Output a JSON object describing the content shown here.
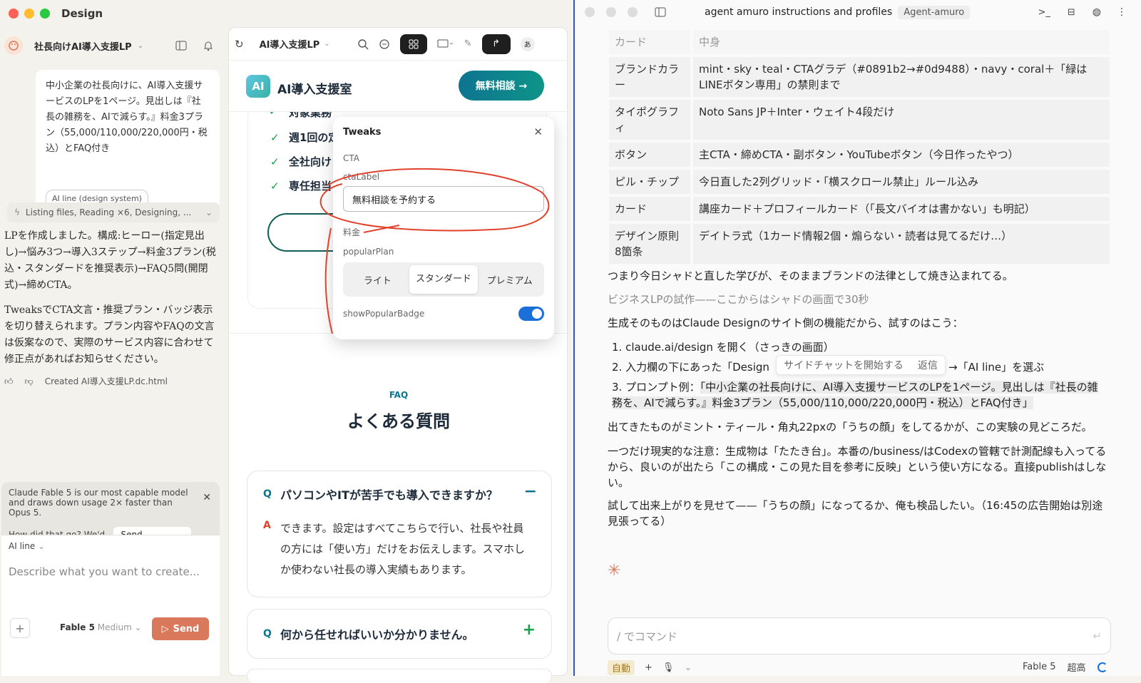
{
  "left_window": {
    "title": "Design",
    "project_name": "社長向けAI導入支援LP",
    "user_prompt": "中小企業の社長向けに、AI導入支援サービスのLPを1ページ。見出しは『社長の雑務を、AIで減らす。』料金3プラン（55,000/110,000/220,000円・税込）とFAQ付き",
    "prompt_tag": "AI line (design system)",
    "activity_label": "Listing files, Reading ×6, Designing, ...",
    "assistant_p1": "LPを作成しました。構成:ヒーロー(指定見出し)→悩み3つ→導入3ステップ→料金3プラン(税込・スタンダードを推奨表示)→FAQ5問(開閉式)→締めCTA。",
    "assistant_p2": "TweaksでCTA文言・推奨プラン・バッジ表示を切り替えられます。プラン内容やFAQの文言は仮案なので、実際のサービス内容に合わせて修正点があればお知らせください。",
    "created_file": "Created AI導入支援LP.dc.html",
    "banner_model": "Claude Fable 5 is our most capable model and draws down usage 2× faster than Opus 5.",
    "banner_feedback": "How did that go? We'd love to hear.",
    "send_feedback_label": "Send feedback",
    "design_system_label": "AI line",
    "composer_placeholder": "Describe what you want to create...",
    "model_name": "Fable 5",
    "model_effort": "Medium",
    "send_label": "Send"
  },
  "preview": {
    "file_tab": "AI導入支援LP",
    "user_initial": "あ",
    "logo_badge": "AI",
    "brand_name": "AI導入支援室",
    "header_cta": "無料相談 →",
    "checklist": [
      "対象業務",
      "週1回の定",
      "全社向け",
      "専任担当"
    ],
    "faq_eyebrow": "FAQ",
    "faq_title": "よくある質問",
    "faq_items": [
      {
        "q_mark": "Q",
        "question": "パソコンやITが苦手でも導入できますか？",
        "toggle": "−",
        "a_mark": "A",
        "answer": "できます。設定はすべてこちらで行い、社長や社員の方には「使い方」だけをお伝えします。スマホしか使わない社長の導入実績もあります。"
      },
      {
        "q_mark": "Q",
        "question": "何から任せればいいか分かりません。",
        "toggle": "+"
      }
    ]
  },
  "tweaks": {
    "title": "Tweaks",
    "section_cta": "CTA",
    "cta_label_name": "ctaLabel",
    "cta_label_value": "無料相談を予約する",
    "section_price": "料金",
    "popular_plan_name": "popularPlan",
    "plans": [
      "ライト",
      "スタンダード",
      "プレミアム"
    ],
    "selected_plan": "スタンダード",
    "badge_name": "showPopularBadge",
    "badge_on": true
  },
  "right_window": {
    "title": "agent amuro instructions and profiles",
    "badge": "Agent-amuro",
    "table_header": [
      "カード",
      "中身"
    ],
    "table_rows": [
      [
        "ブランドカラー",
        "mint・sky・teal・CTAグラデ（#0891b2→#0d9488）・navy・coral＋「緑はLINEボタン専用」の禁則まで"
      ],
      [
        "タイポグラフィ",
        "Noto Sans JP＋Inter・ウェイト4段だけ"
      ],
      [
        "ボタン",
        "主CTA・締めCTA・副ボタン・YouTubeボタン（今日作ったやつ）"
      ],
      [
        "ピル・チップ",
        "今日直した2列グリッド・「横スクロール禁止」ルール込み"
      ],
      [
        "カード",
        "講座カード＋プロフィールカード（「長文バイオは書かない」も明記）"
      ],
      [
        "デザイン原則8箇条",
        "デイトラ式（1カード情報2個・煽らない・読者は見てるだけ…）"
      ]
    ],
    "line1": "つまり今日シャドと直した学びが、そのままブランドの法律として焼き込まれてる。",
    "heading": "ビジネスLPの試作——ここからはシャドの画面で30秒",
    "line2": "生成そのものはClaude Designのサイト側の機能だから、試すのはこう：",
    "step1": "claude.ai/design を開く（さっきの画面）",
    "step2_a": "入力欄の下にあった「Design",
    "step2_popup_1": "サイドチャットを開始する",
    "step2_popup_2": "返信",
    "step2_b": "→「AI line」を選ぶ",
    "step3_a": "プロンプト例：",
    "step3_b": "「中小企業の社長向けに、AI導入支援サービスのLPを1ページ。見出しは『社長の雑務を、AIで減らす。』料金3プラン（55,000/110,000/220,000円・税込）とFAQ付き」",
    "line3": "出てきたものがミント・ティール・角丸22pxの「うちの顔」をしてるかが、この実験の見どころだ。",
    "line4": "一つだけ現実的な注意：生成物は「たたき台」。本番の/business/はCodexの管轄で計測配線も入ってるから、良いのが出たら「この構成・この見た目を参考に反映」という使い方になる。直接publishはしない。",
    "line5": "試して出来上がりを見せて——「うちの顔」になってるか、俺も検品したい。（16:45の広告開始は別途見張ってる）",
    "input_placeholder": "/ でコマンド",
    "mode": "自動",
    "model": "Fable 5",
    "effort": "超高"
  },
  "colors": {
    "accent_teal": "#0e7490",
    "send_coral": "#d9785b",
    "toggle_blue": "#1a6fd8",
    "annotation_red": "#e2412c"
  }
}
